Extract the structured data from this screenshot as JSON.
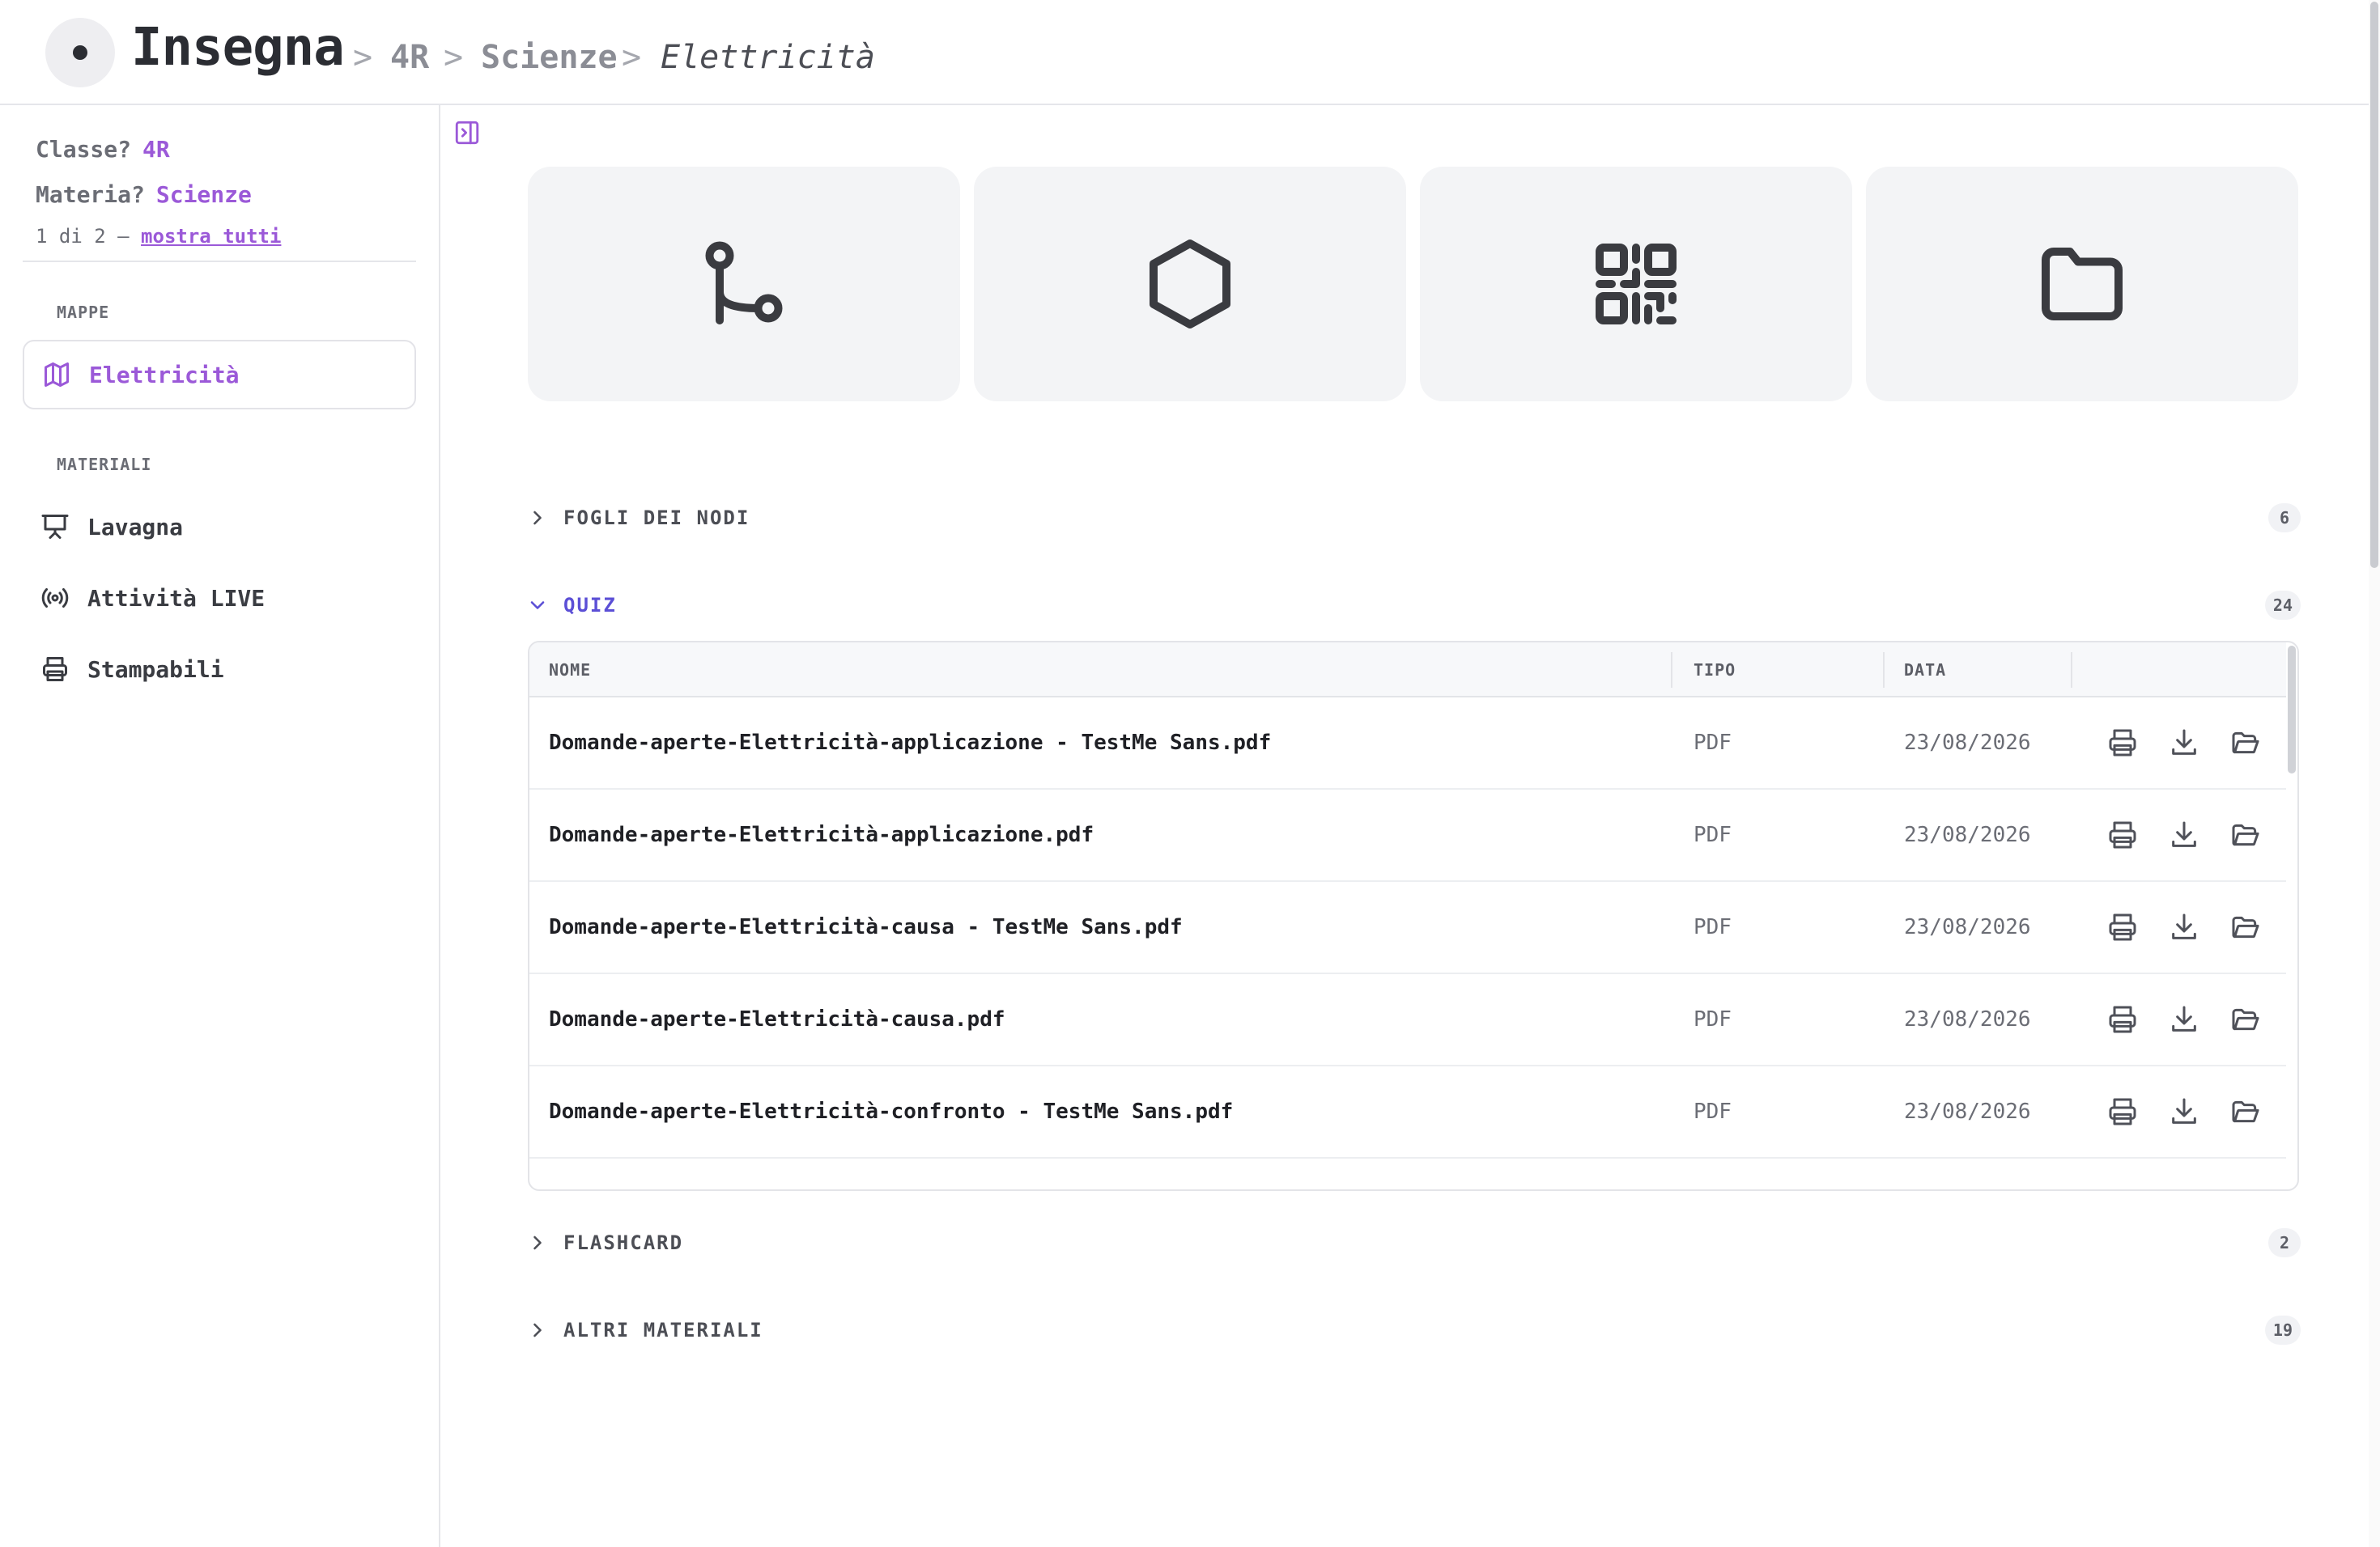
{
  "header": {
    "brand": "Insegna",
    "breadcrumb": [
      "4R",
      "Scienze",
      "Elettricità"
    ],
    "separator": ">"
  },
  "sidebar": {
    "class_label": "Classe?",
    "class_value": "4R",
    "subject_label": "Materia?",
    "subject_value": "Scienze",
    "pager_text": "1 di 2 —",
    "show_all": "mostra tutti",
    "maps_label": "MAPPE",
    "maps": [
      {
        "label": "Elettricità",
        "icon": "map-icon",
        "active": true
      }
    ],
    "materials_label": "MATERIALI",
    "materials": [
      {
        "label": "Lavagna",
        "icon": "presentation-icon"
      },
      {
        "label": "Attività LIVE",
        "icon": "broadcast-icon"
      },
      {
        "label": "Stampabili",
        "icon": "printer-icon"
      }
    ]
  },
  "cards": [
    {
      "icon": "git-branch-icon"
    },
    {
      "icon": "hexagon-icon"
    },
    {
      "icon": "qr-code-icon"
    },
    {
      "icon": "folder-icon"
    }
  ],
  "sections": {
    "nodes": {
      "title": "FOGLI DEI NODI",
      "count": "6"
    },
    "quiz": {
      "title": "QUIZ",
      "count": "24"
    },
    "flashcard": {
      "title": "FLASHCARD",
      "count": "2"
    },
    "other": {
      "title": "ALTRI MATERIALI",
      "count": "19"
    }
  },
  "table": {
    "columns": {
      "name": "NOME",
      "type": "TIPO",
      "date": "DATA"
    },
    "rows": [
      {
        "name": "Domande-aperte-Elettricità-applicazione - TestMe Sans.pdf",
        "type": "PDF",
        "date": "23/08/2026"
      },
      {
        "name": "Domande-aperte-Elettricità-applicazione.pdf",
        "type": "PDF",
        "date": "23/08/2026"
      },
      {
        "name": "Domande-aperte-Elettricità-causa - TestMe Sans.pdf",
        "type": "PDF",
        "date": "23/08/2026"
      },
      {
        "name": "Domande-aperte-Elettricità-causa.pdf",
        "type": "PDF",
        "date": "23/08/2026"
      },
      {
        "name": "Domande-aperte-Elettricità-confronto - TestMe Sans.pdf",
        "type": "PDF",
        "date": "23/08/2026"
      }
    ],
    "row_actions": [
      "printer-icon",
      "download-icon",
      "folder-open-icon"
    ]
  },
  "colors": {
    "accent": "#9b59d8",
    "section_open": "#5b4fd6",
    "card_bg": "#f3f4f6"
  }
}
